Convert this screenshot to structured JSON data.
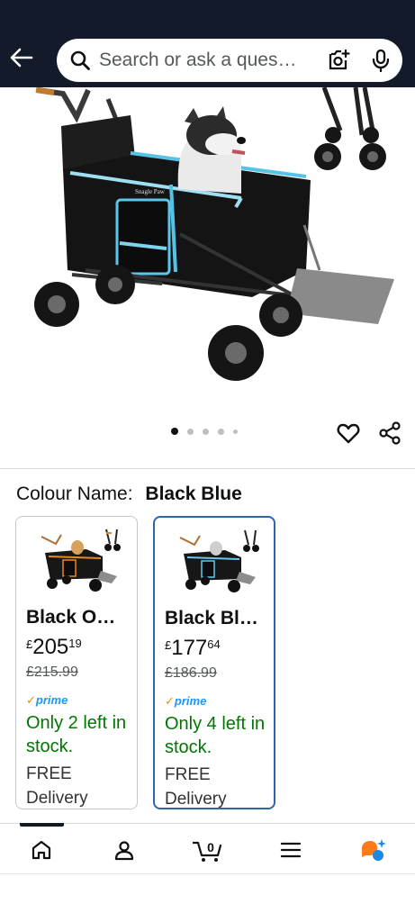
{
  "header": {
    "back_icon": "back-arrow-icon",
    "search": {
      "placeholder": "Search or ask a ques…",
      "camera_icon": "camera-search-icon",
      "mic_icon": "microphone-icon"
    }
  },
  "gallery": {
    "image_count": 5,
    "active_index": 0,
    "product_logo": "Snagle Paw",
    "actions": [
      "heart-icon",
      "share-icon"
    ]
  },
  "variation": {
    "label": "Colour Name:",
    "selected": "Black Blue",
    "options": [
      {
        "name": "Black O…",
        "currency": "£",
        "price_whole": "205",
        "price_fraction": "19",
        "was": "£215.99",
        "prime": "prime",
        "stock": "Only 2 left in stock.",
        "delivery": "FREE Delivery",
        "selected": false
      },
      {
        "name": "Black Bl…",
        "currency": "£",
        "price_whole": "177",
        "price_fraction": "64",
        "was": "£186.99",
        "prime": "prime",
        "stock": "Only 4 left in stock.",
        "delivery": "FREE Delivery",
        "selected": true
      }
    ]
  },
  "nav": {
    "items": [
      "home-icon",
      "account-icon",
      "cart-icon",
      "menu-icon",
      "rufus-icon"
    ],
    "cart_count": "0"
  },
  "colors": {
    "header_bg": "#131b2a",
    "selected_border": "#2f66a8",
    "stock_green": "#007600",
    "prime_blue": "#1a98ff",
    "accent_orange": "#f08804"
  }
}
